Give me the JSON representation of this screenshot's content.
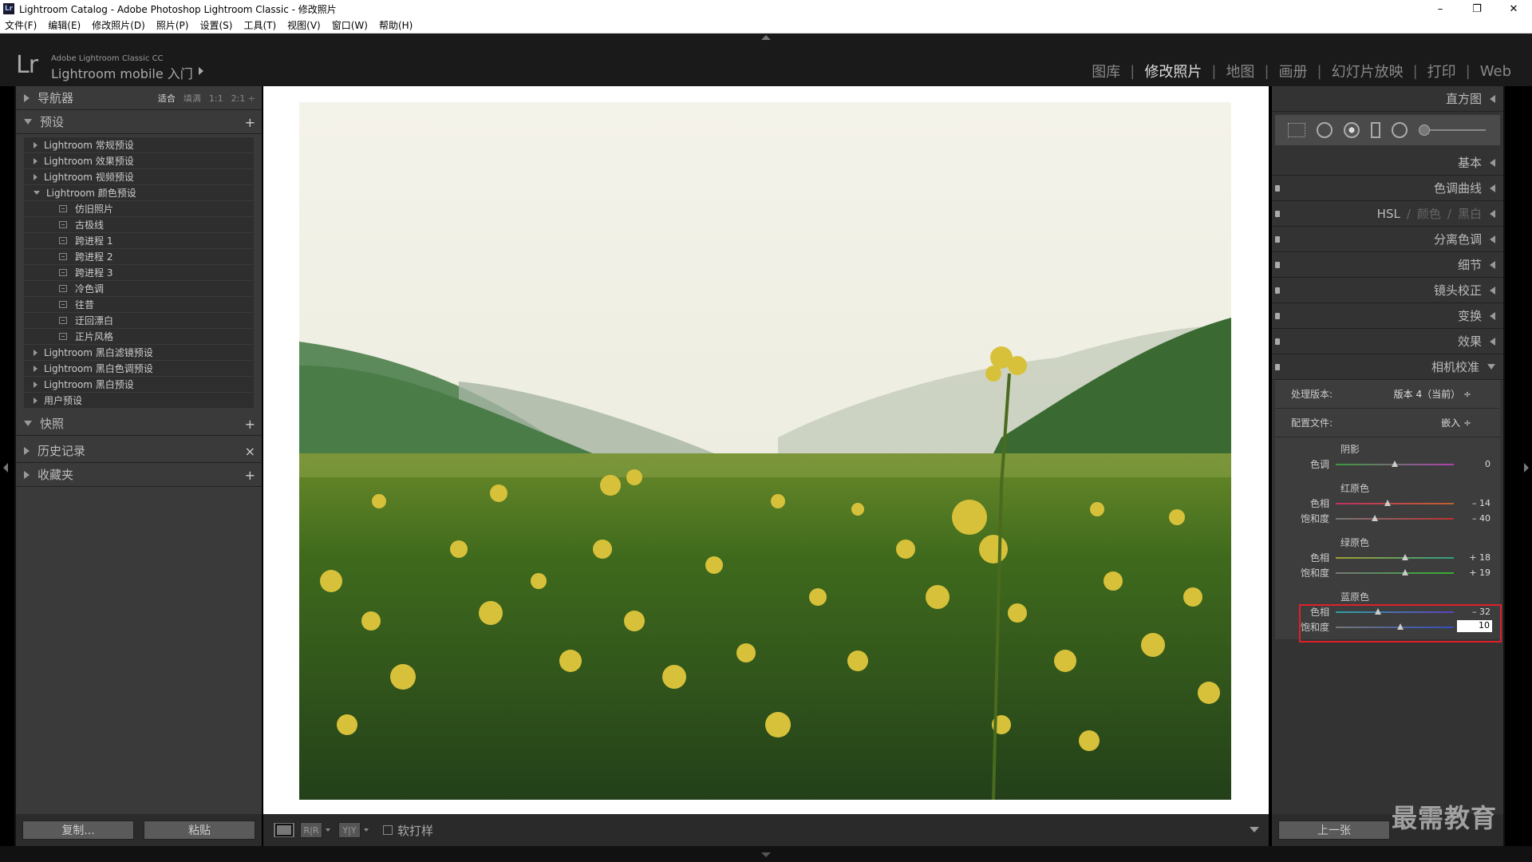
{
  "window": {
    "title": "Lightroom Catalog - Adobe Photoshop Lightroom Classic - 修改照片",
    "controls": [
      "–",
      "❐",
      "✕"
    ]
  },
  "menu": [
    "文件(F)",
    "编辑(E)",
    "修改照片(D)",
    "照片(P)",
    "设置(S)",
    "工具(T)",
    "视图(V)",
    "窗口(W)",
    "帮助(H)"
  ],
  "identity": {
    "logo": "Lr",
    "product": "Adobe Lightroom Classic CC",
    "mobile": "Lightroom mobile 入门"
  },
  "modules": [
    {
      "label": "图库",
      "active": false
    },
    {
      "label": "修改照片",
      "active": true
    },
    {
      "label": "地图",
      "active": false
    },
    {
      "label": "画册",
      "active": false
    },
    {
      "label": "幻灯片放映",
      "active": false
    },
    {
      "label": "打印",
      "active": false
    },
    {
      "label": "Web",
      "active": false
    }
  ],
  "left_panel": {
    "navigator": {
      "title": "导航器",
      "options": [
        "适合",
        "填满",
        "1:1",
        "2:1 ÷"
      ]
    },
    "presets": {
      "title": "预设",
      "items": [
        {
          "label": "Lightroom 常规预设",
          "level": 0,
          "expanded": false
        },
        {
          "label": "Lightroom 效果预设",
          "level": 0,
          "expanded": false
        },
        {
          "label": "Lightroom 视频预设",
          "level": 0,
          "expanded": false
        },
        {
          "label": "Lightroom 颜色预设",
          "level": 0,
          "expanded": true
        },
        {
          "label": "仿旧照片",
          "level": 1
        },
        {
          "label": "古极线",
          "level": 1
        },
        {
          "label": "跨进程 1",
          "level": 1
        },
        {
          "label": "跨进程 2",
          "level": 1
        },
        {
          "label": "跨进程 3",
          "level": 1
        },
        {
          "label": "冷色调",
          "level": 1
        },
        {
          "label": "往昔",
          "level": 1
        },
        {
          "label": "迂回漂白",
          "level": 1
        },
        {
          "label": "正片风格",
          "level": 1
        },
        {
          "label": "Lightroom 黑白滤镜预设",
          "level": 0,
          "expanded": false
        },
        {
          "label": "Lightroom 黑白色调预设",
          "level": 0,
          "expanded": false
        },
        {
          "label": "Lightroom 黑白预设",
          "level": 0,
          "expanded": false
        },
        {
          "label": "用户预设",
          "level": 0,
          "expanded": false
        }
      ]
    },
    "snapshots": {
      "title": "快照"
    },
    "history": {
      "title": "历史记录"
    },
    "collections": {
      "title": "收藏夹"
    },
    "copy_button": "复制...",
    "paste_button": "粘贴"
  },
  "toolbar": {
    "view_buttons": [
      "R|R",
      "Y|Y"
    ],
    "soft_proof": "软打样"
  },
  "right_panel": {
    "panels": {
      "histogram": "直方图",
      "basic": "基本",
      "tone_curve": "色调曲线",
      "hsl": [
        "HSL",
        "/",
        "颜色",
        "/",
        "黑白"
      ],
      "split_toning": "分离色调",
      "detail": "细节",
      "lens": "镜头校正",
      "transform": "变换",
      "effects": "效果",
      "calibration": "相机校准"
    },
    "calibration": {
      "process_label": "处理版本:",
      "process_value": "版本 4（当前） ÷",
      "profile_label": "配置文件:",
      "profile_value": "嵌入 ÷",
      "groups": [
        {
          "title": "阴影",
          "sliders": [
            {
              "label": "色调",
              "value": "0",
              "position": 0.5,
              "gradient": "linear-gradient(90deg,#3c9a3c,#b040b0)"
            }
          ]
        },
        {
          "title": "红原色",
          "sliders": [
            {
              "label": "色相",
              "value": "– 14",
              "position": 0.44,
              "gradient": "linear-gradient(90deg,#c03060,#c06030)"
            },
            {
              "label": "饱和度",
              "value": "– 40",
              "position": 0.33,
              "gradient": "linear-gradient(90deg,#777,#c03030)"
            }
          ]
        },
        {
          "title": "绿原色",
          "sliders": [
            {
              "label": "色相",
              "value": "+ 18",
              "position": 0.59,
              "gradient": "linear-gradient(90deg,#a0a030,#30a080)"
            },
            {
              "label": "饱和度",
              "value": "+ 19",
              "position": 0.59,
              "gradient": "linear-gradient(90deg,#777,#30b030)"
            }
          ]
        },
        {
          "title": "蓝原色",
          "sliders": [
            {
              "label": "色相",
              "value": "– 32",
              "position": 0.36,
              "gradient": "linear-gradient(90deg,#30a0a0,#6040c0)"
            },
            {
              "label": "饱和度",
              "value": "10",
              "position": 0.55,
              "gradient": "linear-gradient(90deg,#777,#3050c0)",
              "editing": true
            }
          ]
        }
      ]
    },
    "prev_button": "上一张",
    "watermark": "最需教育"
  },
  "colors": {
    "highlight": "#e0202a"
  }
}
